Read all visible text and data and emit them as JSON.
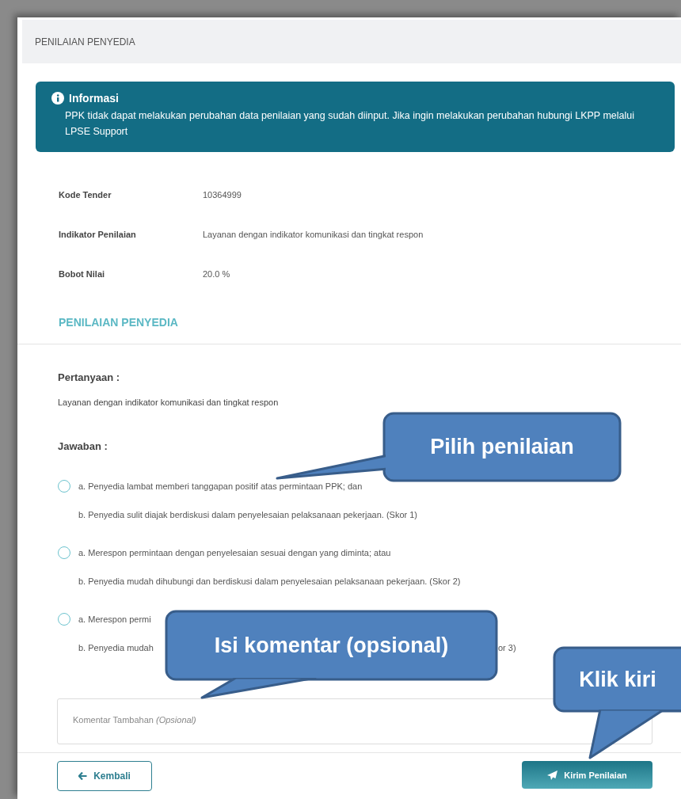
{
  "header": {
    "title": "PENILAIAN PENYEDIA"
  },
  "info": {
    "title": "Informasi",
    "message": "PPK tidak dapat melakukan perubahan data penilaian yang sudah diinput. Jika ingin melakukan perubahan hubungi LKPP melalui LPSE Support"
  },
  "details": [
    {
      "label": "Kode Tender",
      "value": "10364999"
    },
    {
      "label": "Indikator Penilaian",
      "value": "Layanan dengan indikator komunikasi dan tingkat respon"
    },
    {
      "label": "Bobot Nilai",
      "value": "20.0 %"
    }
  ],
  "section_title": "PENILAIAN PENYEDIA",
  "question": {
    "label": "Pertanyaan :",
    "text": "Layanan dengan indikator komunikasi dan tingkat respon"
  },
  "answer_label": "Jawaban :",
  "options": [
    {
      "selected": false,
      "lines": [
        {
          "text": "a. Penyedia lambat memberi tanggapan positif atas permintaan PPK; dan"
        },
        {
          "text": "b. Penyedia sulit diajak berdiskusi dalam penyelesaian pelaksanaan pekerjaan. (Skor 1)"
        }
      ]
    },
    {
      "selected": false,
      "lines": [
        {
          "text": "a. Merespon permintaan dengan penyelesaian sesuai dengan yang diminta; atau"
        },
        {
          "text": "b. Penyedia mudah dihubungi dan berdiskusi dalam penyelesaian pelaksanaan pekerjaan. (Skor 2)"
        }
      ]
    },
    {
      "selected": false,
      "lines": [
        {
          "text": "a. Merespon permi"
        },
        {
          "text": "b. Penyedia mudah",
          "tail": "or 3)"
        }
      ]
    }
  ],
  "comment": {
    "placeholder": "Komentar Tambahan *(Opsional)*"
  },
  "buttons": {
    "back": "Kembali",
    "submit": "Kirim Penilaian"
  },
  "callouts": [
    {
      "text": "Pilih penilaian"
    },
    {
      "text": "Isi komentar (opsional)"
    },
    {
      "text": "Klik kiri"
    }
  ]
}
